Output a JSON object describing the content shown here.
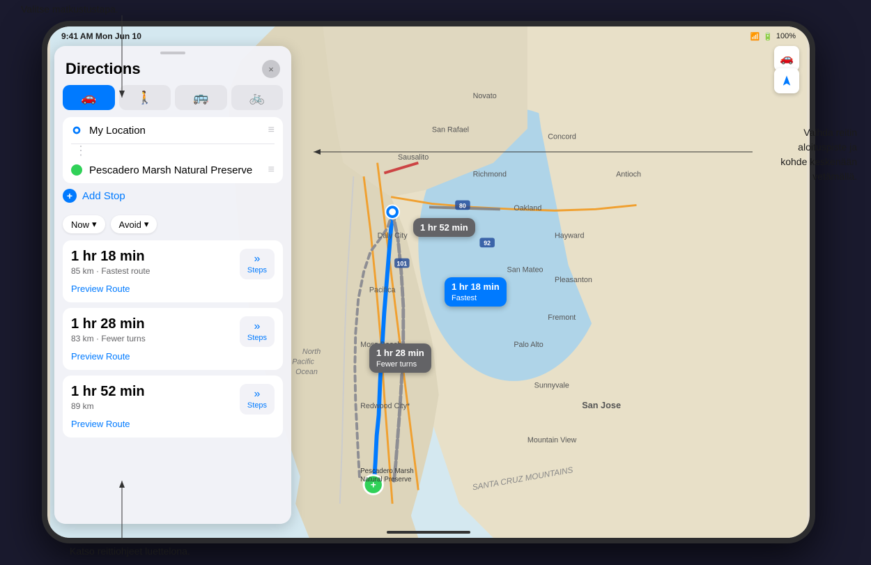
{
  "annotations": {
    "top": "Valitse matkustustapa.",
    "right_line1": "Vaihda reitin",
    "right_line2": "aloituspiste ja",
    "right_line3": "kohde keskenään",
    "right_line4": "vetämällä.",
    "bottom": "Katso reittiohjeet luettelona."
  },
  "status_bar": {
    "time": "9:41 AM Mon Jun 10",
    "wifi": "WiFi",
    "battery": "100%"
  },
  "panel": {
    "title": "Directions",
    "close_label": "×",
    "handle": ""
  },
  "transport_modes": [
    {
      "id": "car",
      "icon": "🚗",
      "active": true
    },
    {
      "id": "walk",
      "icon": "🚶",
      "active": false
    },
    {
      "id": "transit",
      "icon": "🚌",
      "active": false
    },
    {
      "id": "bike",
      "icon": "🚲",
      "active": false
    }
  ],
  "route_from": {
    "label": "My Location",
    "icon": "location"
  },
  "route_to": {
    "label": "Pescadero Marsh Natural Preserve",
    "icon": "destination"
  },
  "add_stop": {
    "label": "Add Stop"
  },
  "options": {
    "time_label": "Now",
    "time_arrow": "▾",
    "avoid_label": "Avoid",
    "avoid_arrow": "▾"
  },
  "routes": [
    {
      "time": "1 hr 18 min",
      "detail": "85 km · Fastest route",
      "steps_label": "Steps",
      "preview_label": "Preview Route",
      "callout_time": "1 hr 18 min",
      "callout_sub": "Fastest",
      "is_fastest": true
    },
    {
      "time": "1 hr 28 min",
      "detail": "83 km · Fewer turns",
      "steps_label": "Steps",
      "preview_label": "Preview Route",
      "callout_time": "1 hr 28 min",
      "callout_sub": "Fewer turns",
      "is_fastest": false
    },
    {
      "time": "1 hr 52 min",
      "detail": "89 km",
      "steps_label": "Steps",
      "preview_label": "Preview Route",
      "callout_time": "1 hr 52 min",
      "callout_sub": "",
      "is_fastest": false
    }
  ],
  "map": {
    "start_marker": "📍",
    "end_label": "Pescadero Marsh\nNatural Preserve"
  }
}
